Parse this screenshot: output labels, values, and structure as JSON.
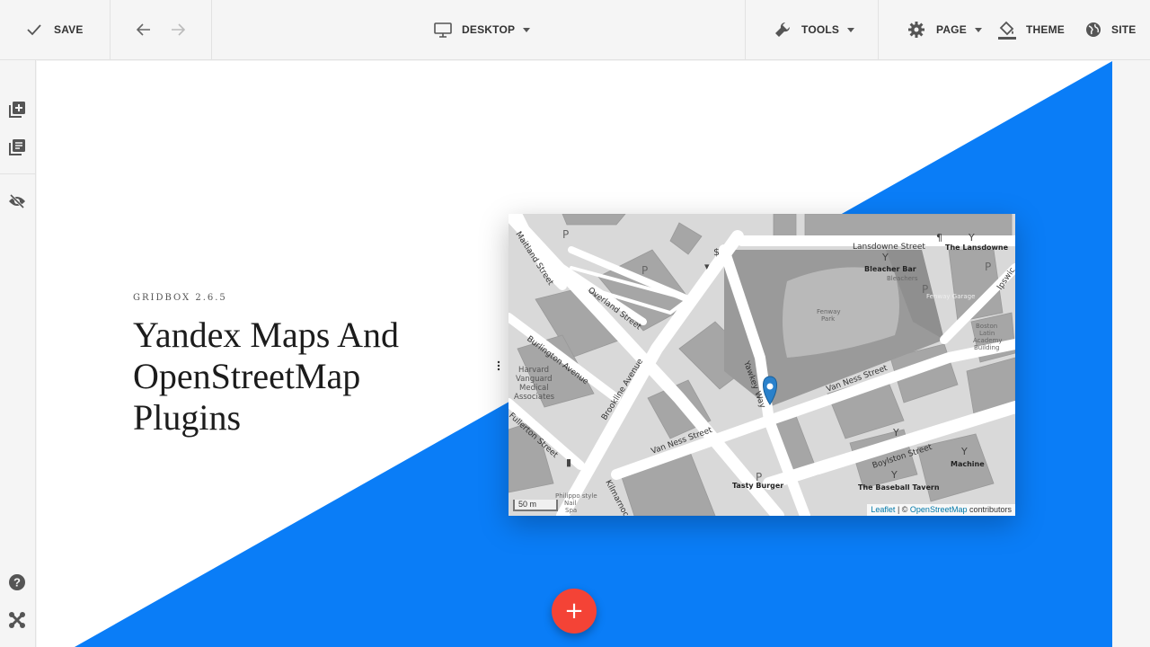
{
  "toolbar": {
    "save_label": "SAVE",
    "desktop_label": "DESKTOP",
    "tools_label": "TOOLS",
    "page_label": "PAGE",
    "theme_label": "THEME",
    "site_label": "SITE"
  },
  "sidebar": {
    "icons": [
      "add-element-icon",
      "library-icon",
      "visibility-off-icon",
      "help-icon",
      "joomla-icon"
    ]
  },
  "hero": {
    "pre_title": "GRIDBOX 2.6.5",
    "title_lines": [
      "Yandex Maps And",
      "OpenStreetMap",
      "Plugins"
    ]
  },
  "map": {
    "labels": {
      "maitland": "Maitland Street",
      "overland": "Overland Street",
      "burlington": "Burlington Avenue",
      "brookline": "Brookline Avenue",
      "fullerton": "Fullerton Street",
      "kilmarnock": "Kilmarnoc",
      "harvard": [
        "Harvard",
        "Vanguard",
        "Medical",
        "Associates"
      ],
      "yawkey": "Yawkey Way",
      "van_ness_1": "Van Ness Street",
      "van_ness_2": "Van Ness Street",
      "lansdowne": "Lansdowne Street",
      "the_lansdowne": "The Lansdowne",
      "bleacher_bar": "Bleacher Bar",
      "bleachers": "Bleachers",
      "fenway_park": [
        "Fenway",
        "Park"
      ],
      "fenway_garage": "Fenway Garage",
      "boston_latin": [
        "Boston",
        "Latin",
        "Academy",
        "Building"
      ],
      "ipswich": "Ipswic",
      "boylston": "Boylston Street",
      "machine": "Machine",
      "baseball_tavern": "The Baseball Tavern",
      "tasty_burger": "Tasty Burger",
      "spa": [
        "Philippo style",
        "Nail",
        "Spa"
      ]
    },
    "scale": "50 m",
    "attribution": {
      "leaflet": "Leaflet",
      "separator": " | © ",
      "osm": "OpenStreetMap",
      "suffix": " contributors"
    }
  },
  "fab_label": "+",
  "colors": {
    "accent_blue": "#0a7df7",
    "fab_red": "#f44336",
    "marker_blue": "#2a81cb"
  }
}
